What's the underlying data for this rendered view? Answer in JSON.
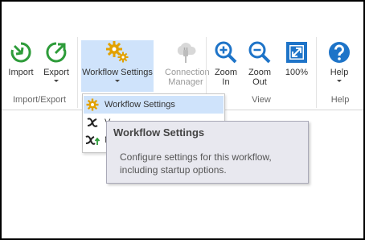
{
  "ribbon": {
    "groups": [
      {
        "label": "Import/Export"
      },
      {
        "label": ""
      },
      {
        "label": "View"
      },
      {
        "label": "Help"
      }
    ],
    "buttons": {
      "import": {
        "label": "Import"
      },
      "export": {
        "label": "Export"
      },
      "workflow_settings": {
        "label": "Workflow Settings"
      },
      "connection_manager": {
        "line1": "Connection",
        "line2": "Manager"
      },
      "zoom_in": {
        "line1": "Zoom",
        "line2": "In"
      },
      "zoom_out": {
        "line1": "Zoom",
        "line2": "Out"
      },
      "zoom_100": {
        "label": "100%"
      },
      "help": {
        "label": "Help"
      }
    }
  },
  "dropdown": {
    "items": [
      {
        "label": "Workflow Settings",
        "icon": "gear-icon"
      },
      {
        "label": "V",
        "icon": "variable-x-icon"
      },
      {
        "label": "N",
        "icon": "variable-x-arrow-icon"
      }
    ]
  },
  "tooltip": {
    "title": "Workflow Settings",
    "body": "Configure settings for this workflow, including startup options."
  },
  "colors": {
    "accent": "#1e74c8",
    "green": "#2e9c3a",
    "gear": "#e2a100",
    "selection": "#cfe3fb",
    "tooltip_bg": "#e8e8ef"
  }
}
